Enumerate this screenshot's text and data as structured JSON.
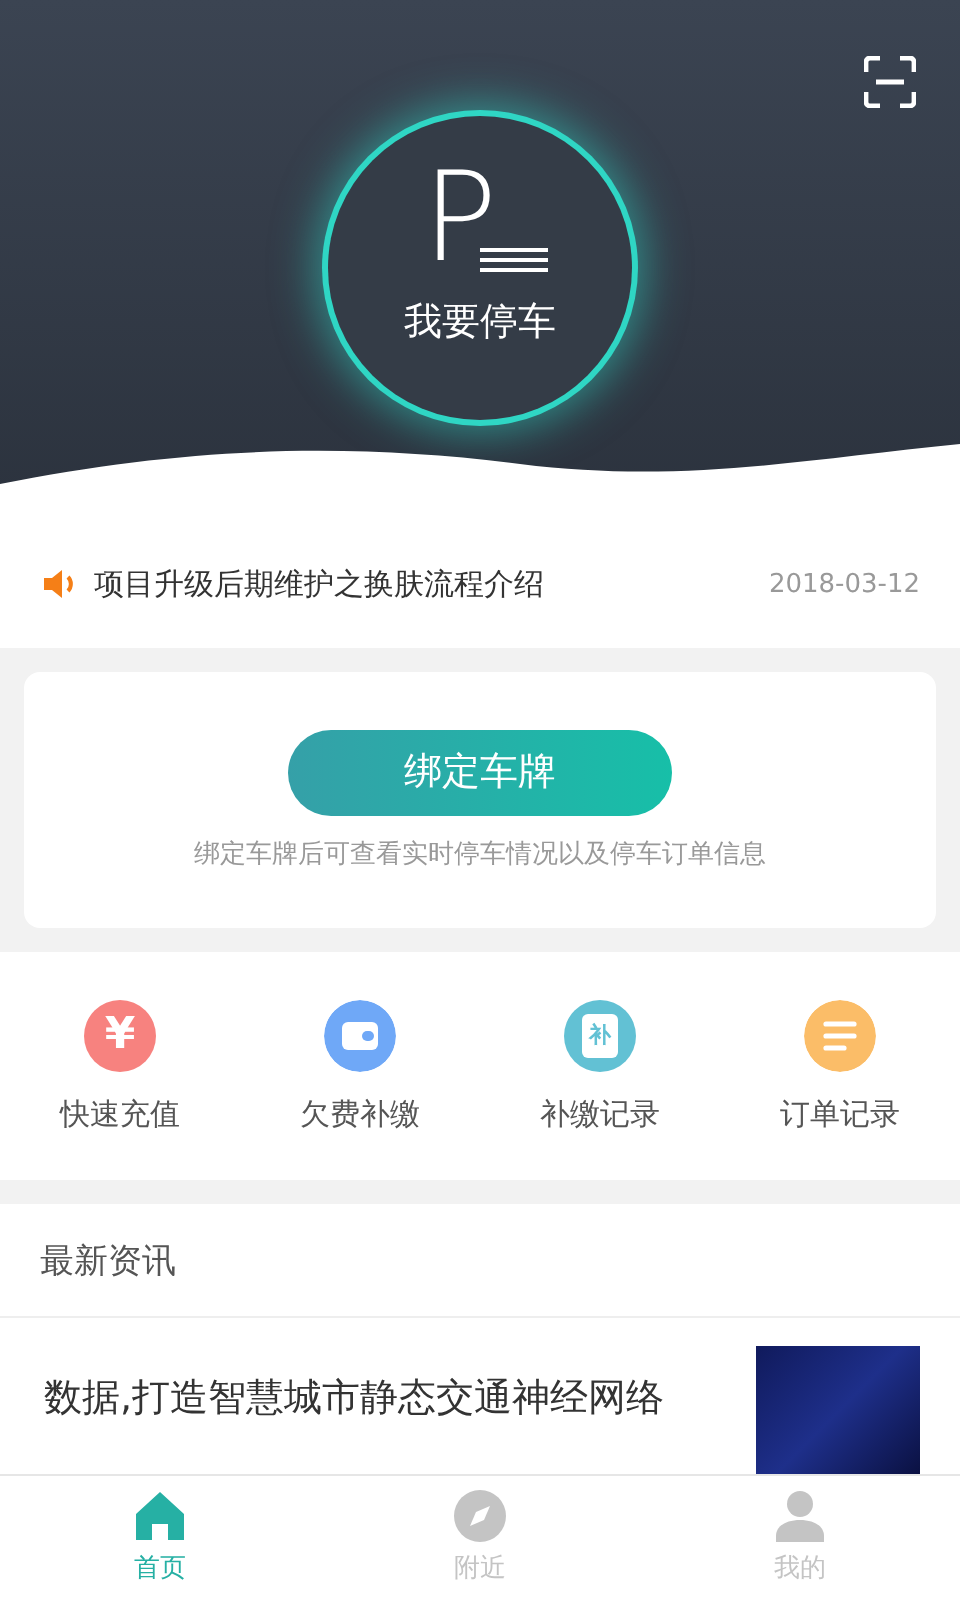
{
  "header": {
    "park_button": {
      "letter": "P",
      "label": "我要停车"
    }
  },
  "notice": {
    "text": "项目升级后期维护之换肤流程介绍",
    "date": "2018-03-12"
  },
  "bind_card": {
    "button": "绑定车牌",
    "hint": "绑定车牌后可查看实时停车情况以及停车订单信息"
  },
  "shortcuts": [
    {
      "kind": "yuan",
      "glyph": "¥",
      "label": "快速充值",
      "color": "#f7827f"
    },
    {
      "kind": "wallet",
      "label": "欠费补缴",
      "color": "#6fa8f7"
    },
    {
      "kind": "badge",
      "glyph": "补",
      "label": "补缴记录",
      "color": "#62c1d4"
    },
    {
      "kind": "lines",
      "label": "订单记录",
      "color": "#fbbd68"
    }
  ],
  "news": {
    "title": "最新资讯",
    "items": [
      {
        "headline": "数据,打造智慧城市静态交通神经网络"
      }
    ]
  },
  "tabs": [
    {
      "kind": "home",
      "label": "首页",
      "selected": true
    },
    {
      "kind": "compass",
      "label": "附近",
      "selected": false
    },
    {
      "kind": "person",
      "label": "我的",
      "selected": false
    }
  ]
}
